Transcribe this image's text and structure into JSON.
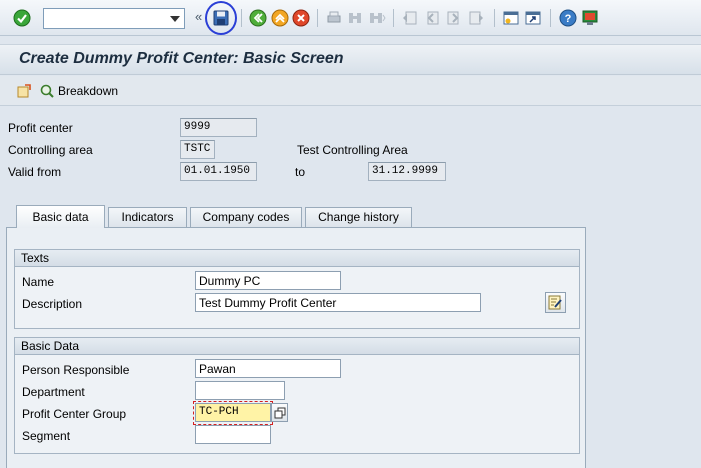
{
  "toolbar": {
    "command_value": "",
    "icons": [
      "enter-icon",
      "save-icon",
      "back-icon",
      "exit-icon",
      "cancel-icon",
      "print-icon",
      "find-icon",
      "find-next-icon",
      "first-page-icon",
      "previous-page-icon",
      "next-page-icon",
      "last-page-icon",
      "new-session-icon",
      "shortcut-icon",
      "help-icon",
      "layout-icon"
    ],
    "double_arrow": "«"
  },
  "title": "Create Dummy Profit Center: Basic Screen",
  "app_toolbar": {
    "breakdown_label": "Breakdown"
  },
  "header": {
    "profit_center_label": "Profit center",
    "profit_center_value": "9999",
    "controlling_area_label": "Controlling area",
    "controlling_area_value": "TSTC",
    "controlling_area_text": "Test Controlling Area",
    "valid_from_label": "Valid from",
    "valid_from_value": "01.01.1950",
    "to_label": "to",
    "valid_to_value": "31.12.9999"
  },
  "tabs": [
    {
      "label": "Basic data",
      "active": true
    },
    {
      "label": "Indicators",
      "active": false
    },
    {
      "label": "Company codes",
      "active": false
    },
    {
      "label": "Change history",
      "active": false
    }
  ],
  "texts_group": {
    "title": "Texts",
    "name_label": "Name",
    "name_value": "Dummy PC",
    "description_label": "Description",
    "description_value": "Test Dummy Profit Center"
  },
  "basic_group": {
    "title": "Basic Data",
    "person_label": "Person Responsible",
    "person_value": "Pawan",
    "department_label": "Department",
    "department_value": "",
    "pcg_label": "Profit Center Group",
    "pcg_value": "TC-PCH",
    "segment_label": "Segment",
    "segment_value": ""
  },
  "colors": {
    "save_highlight": "#2b3fd6",
    "focus_field": "#fff3a6",
    "focus_border": "#d42020"
  }
}
